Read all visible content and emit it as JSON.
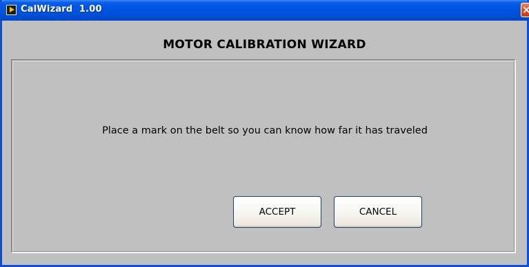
{
  "window": {
    "title": "CalWizard  1.00",
    "close_symbol": "×"
  },
  "icons": {
    "app": "app-icon",
    "close": "close-icon"
  },
  "content": {
    "heading": "MOTOR CALIBRATION WIZARD",
    "message": "Place a mark on the belt so you can know how far it has traveled"
  },
  "buttons": {
    "accept_label": "ACCEPT",
    "cancel_label": "CANCEL"
  },
  "colors": {
    "titlebar": "#0054e3",
    "window_bg": "#c0c0c0",
    "close_button": "#d8532c"
  }
}
